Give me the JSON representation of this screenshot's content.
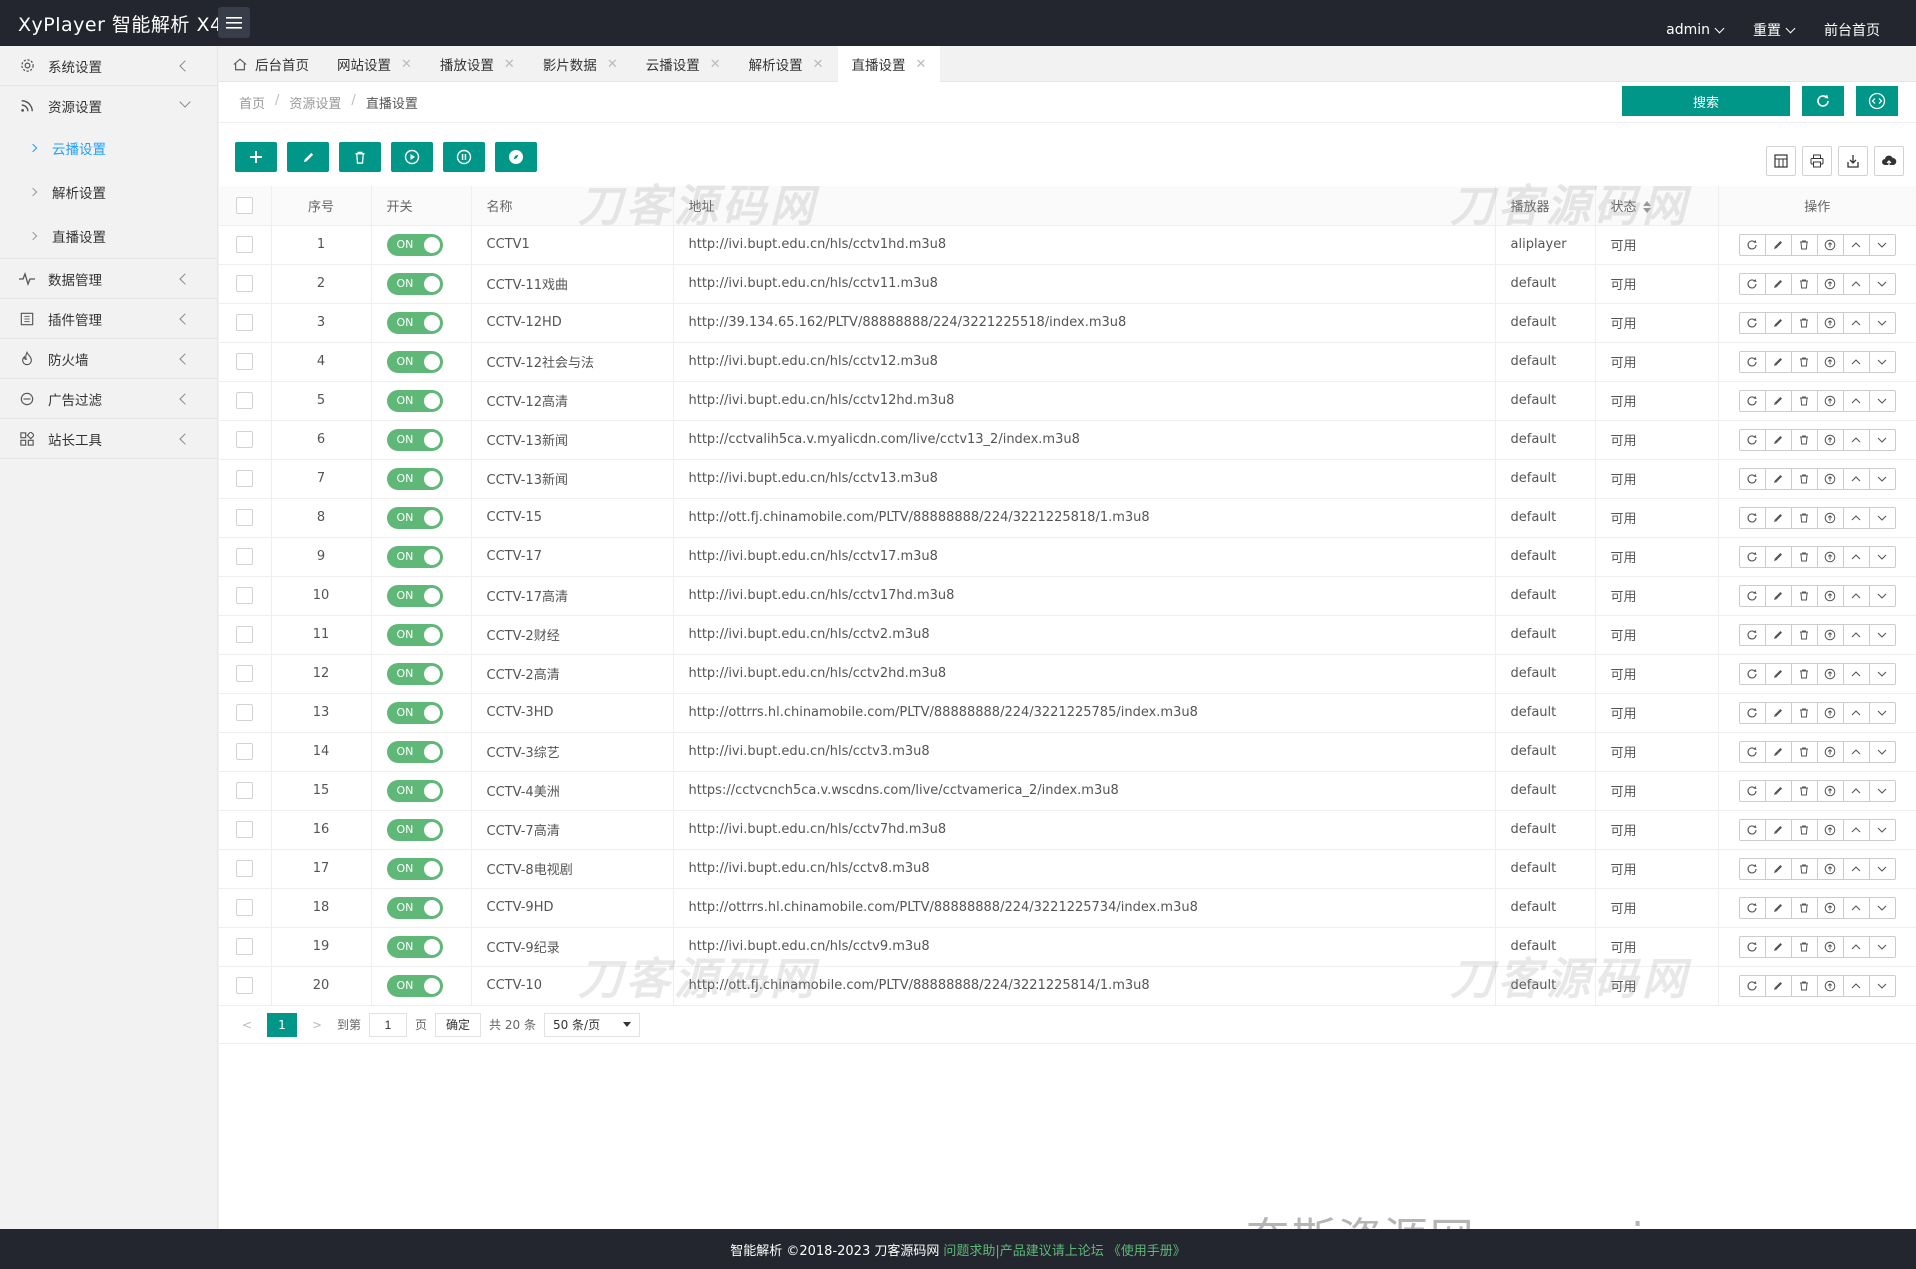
{
  "header": {
    "brand": "XyPlayer 智能解析 X4",
    "user": "admin",
    "reset": "重置",
    "frontend": "前台首页"
  },
  "sidebar": {
    "items": [
      {
        "label": "系统设置",
        "icon": "gear-icon"
      },
      {
        "label": "资源设置",
        "icon": "rss-icon",
        "expanded": true,
        "children": [
          "云播设置",
          "解析设置",
          "直播设置"
        ],
        "active_child": "云播设置"
      },
      {
        "label": "数据管理",
        "icon": "pulse-icon"
      },
      {
        "label": "插件管理",
        "icon": "plugin-icon"
      },
      {
        "label": "防火墙",
        "icon": "fire-icon"
      },
      {
        "label": "广告过滤",
        "icon": "block-icon"
      },
      {
        "label": "站长工具",
        "icon": "apps-icon"
      }
    ]
  },
  "tabs": [
    {
      "label": "后台首页",
      "closable": false
    },
    {
      "label": "网站设置",
      "closable": true
    },
    {
      "label": "播放设置",
      "closable": true
    },
    {
      "label": "影片数据",
      "closable": true
    },
    {
      "label": "云播设置",
      "closable": true
    },
    {
      "label": "解析设置",
      "closable": true
    },
    {
      "label": "直播设置",
      "closable": true,
      "active": true
    }
  ],
  "breadcrumb": [
    "首页",
    "资源设置",
    "直播设置"
  ],
  "search_label": "搜索",
  "table": {
    "headers": {
      "seq": "序号",
      "switch": "开关",
      "name": "名称",
      "addr": "地址",
      "player": "播放器",
      "status": "状态",
      "ops": "操作"
    },
    "switch_on_label": "ON",
    "rows": [
      {
        "seq": "1",
        "name": "CCTV1",
        "addr": "http://ivi.bupt.edu.cn/hls/cctv1hd.m3u8",
        "player": "aliplayer",
        "status": "可用"
      },
      {
        "seq": "2",
        "name": "CCTV-11戏曲",
        "addr": "http://ivi.bupt.edu.cn/hls/cctv11.m3u8",
        "player": "default",
        "status": "可用"
      },
      {
        "seq": "3",
        "name": "CCTV-12HD",
        "addr": "http://39.134.65.162/PLTV/88888888/224/3221225518/index.m3u8",
        "player": "default",
        "status": "可用"
      },
      {
        "seq": "4",
        "name": "CCTV-12社会与法",
        "addr": "http://ivi.bupt.edu.cn/hls/cctv12.m3u8",
        "player": "default",
        "status": "可用"
      },
      {
        "seq": "5",
        "name": "CCTV-12高清",
        "addr": "http://ivi.bupt.edu.cn/hls/cctv12hd.m3u8",
        "player": "default",
        "status": "可用"
      },
      {
        "seq": "6",
        "name": "CCTV-13新闻",
        "addr": "http://cctvalih5ca.v.myalicdn.com/live/cctv13_2/index.m3u8",
        "player": "default",
        "status": "可用"
      },
      {
        "seq": "7",
        "name": "CCTV-13新闻",
        "addr": "http://ivi.bupt.edu.cn/hls/cctv13.m3u8",
        "player": "default",
        "status": "可用"
      },
      {
        "seq": "8",
        "name": "CCTV-15",
        "addr": "http://ott.fj.chinamobile.com/PLTV/88888888/224/3221225818/1.m3u8",
        "player": "default",
        "status": "可用"
      },
      {
        "seq": "9",
        "name": "CCTV-17",
        "addr": "http://ivi.bupt.edu.cn/hls/cctv17.m3u8",
        "player": "default",
        "status": "可用"
      },
      {
        "seq": "10",
        "name": "CCTV-17高清",
        "addr": "http://ivi.bupt.edu.cn/hls/cctv17hd.m3u8",
        "player": "default",
        "status": "可用"
      },
      {
        "seq": "11",
        "name": "CCTV-2财经",
        "addr": "http://ivi.bupt.edu.cn/hls/cctv2.m3u8",
        "player": "default",
        "status": "可用"
      },
      {
        "seq": "12",
        "name": "CCTV-2高清",
        "addr": "http://ivi.bupt.edu.cn/hls/cctv2hd.m3u8",
        "player": "default",
        "status": "可用"
      },
      {
        "seq": "13",
        "name": "CCTV-3HD",
        "addr": "http://ottrrs.hl.chinamobile.com/PLTV/88888888/224/3221225785/index.m3u8",
        "player": "default",
        "status": "可用"
      },
      {
        "seq": "14",
        "name": "CCTV-3综艺",
        "addr": "http://ivi.bupt.edu.cn/hls/cctv3.m3u8",
        "player": "default",
        "status": "可用"
      },
      {
        "seq": "15",
        "name": "CCTV-4美洲",
        "addr": "https://cctvcnch5ca.v.wscdns.com/live/cctvamerica_2/index.m3u8",
        "player": "default",
        "status": "可用"
      },
      {
        "seq": "16",
        "name": "CCTV-7高清",
        "addr": "http://ivi.bupt.edu.cn/hls/cctv7hd.m3u8",
        "player": "default",
        "status": "可用"
      },
      {
        "seq": "17",
        "name": "CCTV-8电视剧",
        "addr": "http://ivi.bupt.edu.cn/hls/cctv8.m3u8",
        "player": "default",
        "status": "可用"
      },
      {
        "seq": "18",
        "name": "CCTV-9HD",
        "addr": "http://ottrrs.hl.chinamobile.com/PLTV/88888888/224/3221225734/index.m3u8",
        "player": "default",
        "status": "可用"
      },
      {
        "seq": "19",
        "name": "CCTV-9纪录",
        "addr": "http://ivi.bupt.edu.cn/hls/cctv9.m3u8",
        "player": "default",
        "status": "可用"
      },
      {
        "seq": "20",
        "name": "CCTV-10",
        "addr": "http://ott.fj.chinamobile.com/PLTV/88888888/224/3221225814/1.m3u8",
        "player": "default",
        "status": "可用"
      }
    ]
  },
  "pager": {
    "current": "1",
    "goto_label": "到第",
    "goto_value": "1",
    "page_unit": "页",
    "confirm": "确定",
    "total": "共 20 条",
    "per_page": "50 条/页"
  },
  "watermark": "刀客源码网",
  "watermark2": "奈斯资源网www.nicezyw.com",
  "footer": {
    "copyright": "智能解析 ©2018-2023 刀客源码网",
    "help_link": "问题求助|产品建议请上论坛",
    "manual_link": "《使用手册》"
  },
  "colors": {
    "primary": "#009688",
    "switch_on": "#5fb878",
    "header_bg": "#23262e",
    "active_link": "#1e9fff"
  }
}
